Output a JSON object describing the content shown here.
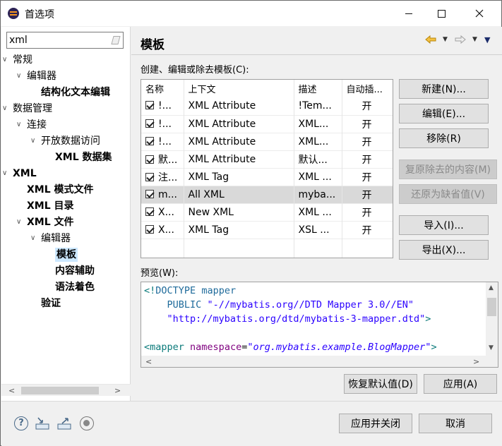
{
  "window": {
    "title": "首选项"
  },
  "filter": {
    "value": "xml"
  },
  "tree": [
    {
      "label": "常规",
      "level": 0,
      "caret": "open",
      "bold": false
    },
    {
      "label": "编辑器",
      "level": 1,
      "caret": "open",
      "bold": false
    },
    {
      "label": "结构化文本编辑",
      "level": 2,
      "caret": "",
      "bold": true
    },
    {
      "label": "数据管理",
      "level": 0,
      "caret": "open",
      "bold": false
    },
    {
      "label": "连接",
      "level": 1,
      "caret": "open",
      "bold": false
    },
    {
      "label": "开放数据访问",
      "level": 2,
      "caret": "open",
      "bold": false
    },
    {
      "label": "XML 数据集",
      "level": 3,
      "caret": "",
      "bold": true
    },
    {
      "label": "XML",
      "level": 0,
      "caret": "open",
      "bold": true
    },
    {
      "label": "XML 模式文件",
      "level": 1,
      "caret": "",
      "bold": true
    },
    {
      "label": "XML 目录",
      "level": 1,
      "caret": "",
      "bold": true
    },
    {
      "label": "XML 文件",
      "level": 1,
      "caret": "open",
      "bold": true
    },
    {
      "label": "编辑器",
      "level": 2,
      "caret": "open",
      "bold": false
    },
    {
      "label": "模板",
      "level": 3,
      "caret": "",
      "bold": true,
      "selected": true
    },
    {
      "label": "内容辅助",
      "level": 3,
      "caret": "",
      "bold": true
    },
    {
      "label": "语法着色",
      "level": 3,
      "caret": "",
      "bold": true
    },
    {
      "label": "验证",
      "level": 2,
      "caret": "",
      "bold": true
    }
  ],
  "page": {
    "title": "模板",
    "section_label": "创建、编辑或除去模板(C):",
    "columns": [
      "名称",
      "上下文",
      "描述",
      "自动插..."
    ],
    "rows": [
      {
        "name": "!...",
        "context": "XML Attribute",
        "desc": "!Tem...",
        "auto": "开"
      },
      {
        "name": "!...",
        "context": "XML Attribute",
        "desc": "XML...",
        "auto": "开"
      },
      {
        "name": "!...",
        "context": "XML Attribute",
        "desc": "XML...",
        "auto": "开"
      },
      {
        "name": "默...",
        "context": "XML Attribute",
        "desc": "默认...",
        "auto": "开"
      },
      {
        "name": "注...",
        "context": "XML Tag",
        "desc": "XML ...",
        "auto": "开"
      },
      {
        "name": "m...",
        "context": "All XML",
        "desc": "myba...",
        "auto": "开",
        "selected": true
      },
      {
        "name": "X...",
        "context": "New XML",
        "desc": "XML ...",
        "auto": "开"
      },
      {
        "name": "X...",
        "context": "XML Tag",
        "desc": "XSL ...",
        "auto": "开"
      }
    ],
    "buttons": {
      "new": "新建(N)...",
      "edit": "编辑(E)...",
      "remove": "移除(R)",
      "restore_removed": "复原除去的内容(M)",
      "revert_default": "还原为缺省值(V)",
      "import": "导入(I)...",
      "export": "导出(X)..."
    },
    "preview_label": "预览(W):",
    "preview_lines": [
      "<!DOCTYPE mapper",
      "    PUBLIC \"-//mybatis.org//DTD Mapper 3.0//EN\"",
      "    \"http://mybatis.org/dtd/mybatis-3-mapper.dtd\">",
      "",
      "<mapper namespace=\"org.mybatis.example.BlogMapper\">"
    ],
    "restore_defaults": "恢复默认值(D)",
    "apply": "应用(A)"
  },
  "footer": {
    "apply_close": "应用并关闭",
    "cancel": "取消"
  },
  "colors": {
    "selection": "#cce8ff",
    "row_selected": "#d9d9d9"
  }
}
